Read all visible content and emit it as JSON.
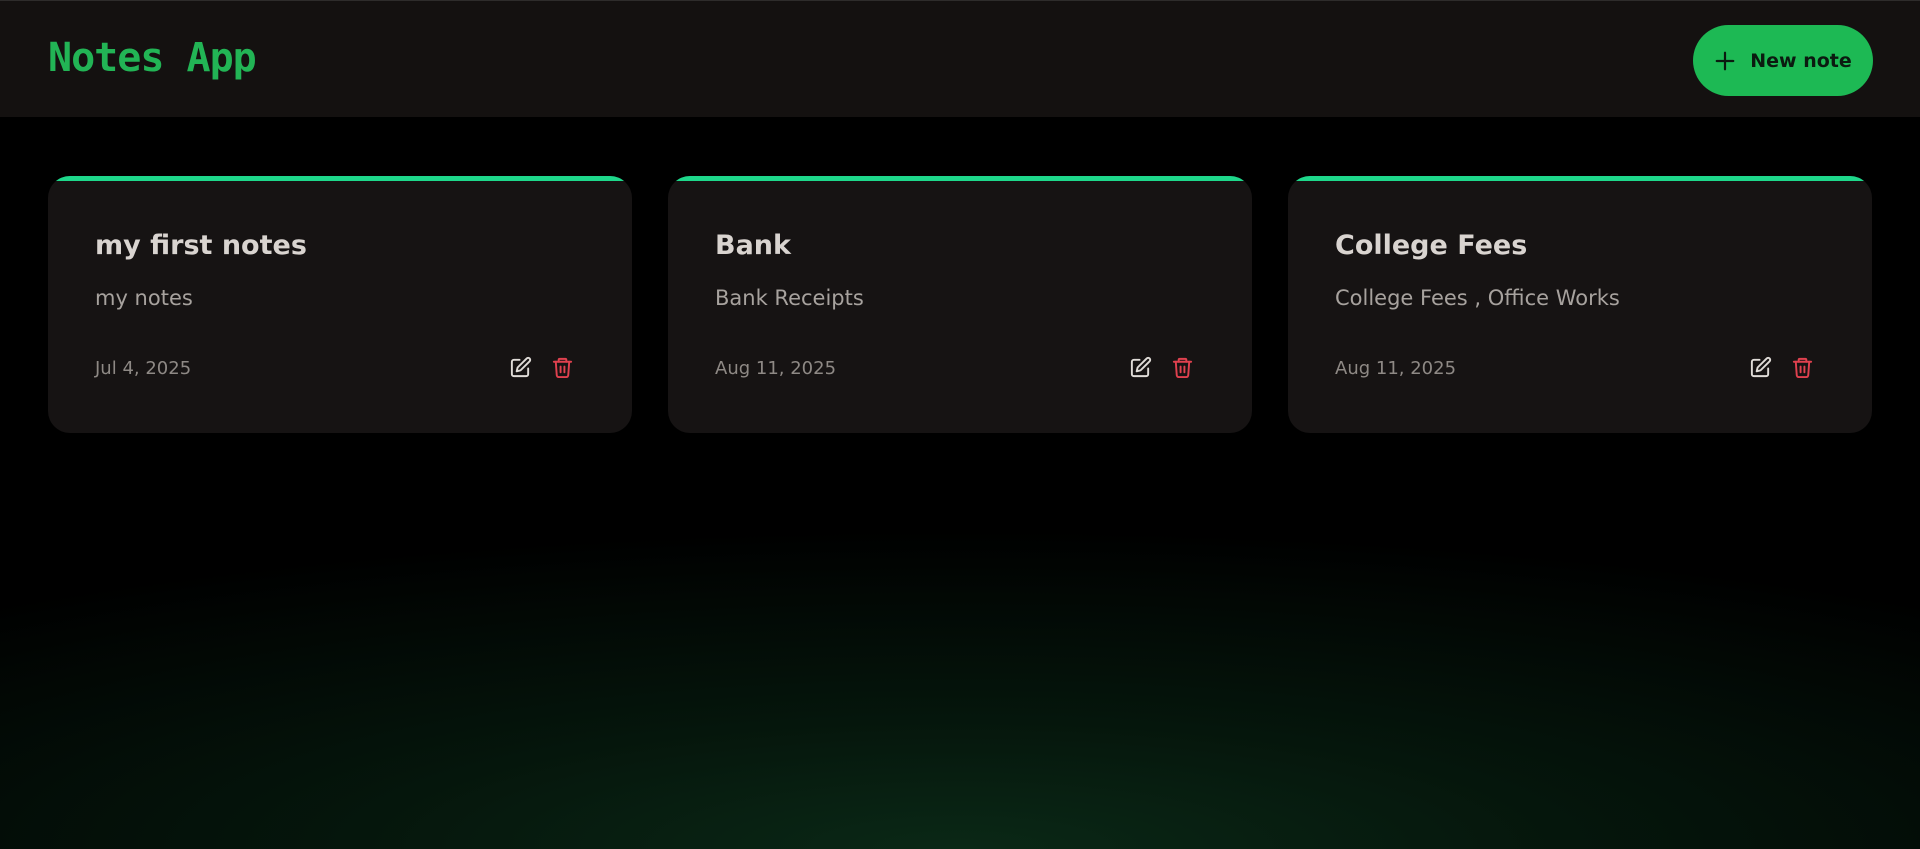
{
  "header": {
    "title": "Notes App",
    "new_note_label": "New note",
    "accent_color": "#1db954"
  },
  "notes": [
    {
      "title": "my first notes",
      "body": "my notes",
      "date": "Jul 4, 2025"
    },
    {
      "title": "Bank",
      "body": "Bank Receipts",
      "date": "Aug 11, 2025"
    },
    {
      "title": "College Fees",
      "body": "College Fees , Office Works",
      "date": "Aug 11, 2025"
    }
  ],
  "icons": {
    "new_note": "plus-icon",
    "edit": "edit-icon",
    "delete": "trash-icon"
  },
  "colors": {
    "card_top_border": "#1ed88b",
    "delete_icon": "#e0414f",
    "edit_icon": "#e0dcd8"
  }
}
